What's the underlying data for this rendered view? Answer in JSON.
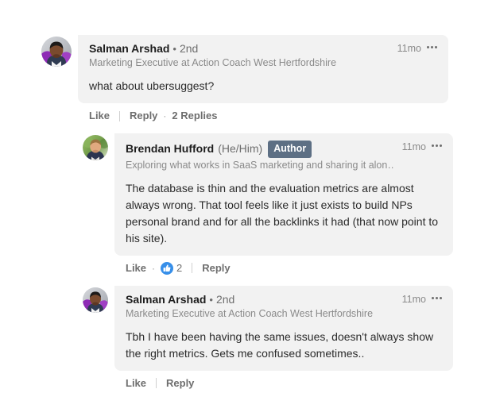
{
  "thread": {
    "comments": [
      {
        "id": "comment-1",
        "level": 0,
        "avatar": "salman-arshad-avatar",
        "author_name": "Salman Arshad",
        "degree_separator": "•",
        "degree": "2nd",
        "pronouns": "",
        "badge": "",
        "headline": "Marketing Executive at Action Coach West Hertfordshire",
        "timestamp": "11mo",
        "more_icon": "more-options-icon",
        "body": "what about ubersuggest?",
        "actions": {
          "like_label": "Like",
          "reply_label": "Reply",
          "dot": "·",
          "replies_label": "2 Replies",
          "reaction_icon": "",
          "reaction_count": ""
        }
      },
      {
        "id": "comment-2",
        "level": 1,
        "avatar": "brendan-hufford-avatar",
        "author_name": "Brendan Hufford",
        "degree_separator": "",
        "degree": "",
        "pronouns": "(He/Him)",
        "badge": "Author",
        "headline": "Exploring what works in SaaS marketing and sharing it alon…",
        "timestamp": "11mo",
        "more_icon": "more-options-icon",
        "body": "The database is thin and the evaluation metrics are almost always wrong. That tool feels like it just exists to build NPs personal brand and for all the backlinks it had (that now point to his site).",
        "actions": {
          "like_label": "Like",
          "reply_label": "Reply",
          "dot": "·",
          "replies_label": "",
          "reaction_icon": "thumbs-up-icon",
          "reaction_count": "2"
        }
      },
      {
        "id": "comment-3",
        "level": 1,
        "avatar": "salman-arshad-avatar",
        "author_name": "Salman Arshad",
        "degree_separator": "•",
        "degree": "2nd",
        "pronouns": "",
        "badge": "",
        "headline": "Marketing Executive at Action Coach West Hertfordshire",
        "timestamp": "11mo",
        "more_icon": "more-options-icon",
        "body": "Tbh I have been having the same issues, doesn't always show the right metrics. Gets me confused sometimes..",
        "actions": {
          "like_label": "Like",
          "reply_label": "Reply",
          "dot": "",
          "replies_label": "",
          "reaction_icon": "",
          "reaction_count": ""
        }
      }
    ]
  },
  "colors": {
    "page_background": "#ffffff",
    "bubble_background": "#f2f2f2",
    "author_badge_background": "#5d6f84",
    "author_badge_text": "#ffffff",
    "reaction_blue": "#378fe9",
    "primary_text": "#1d1d1d",
    "body_text": "#2b2b2b",
    "muted_text": "#6e6e6e",
    "headline_text": "#8a8a8a"
  }
}
